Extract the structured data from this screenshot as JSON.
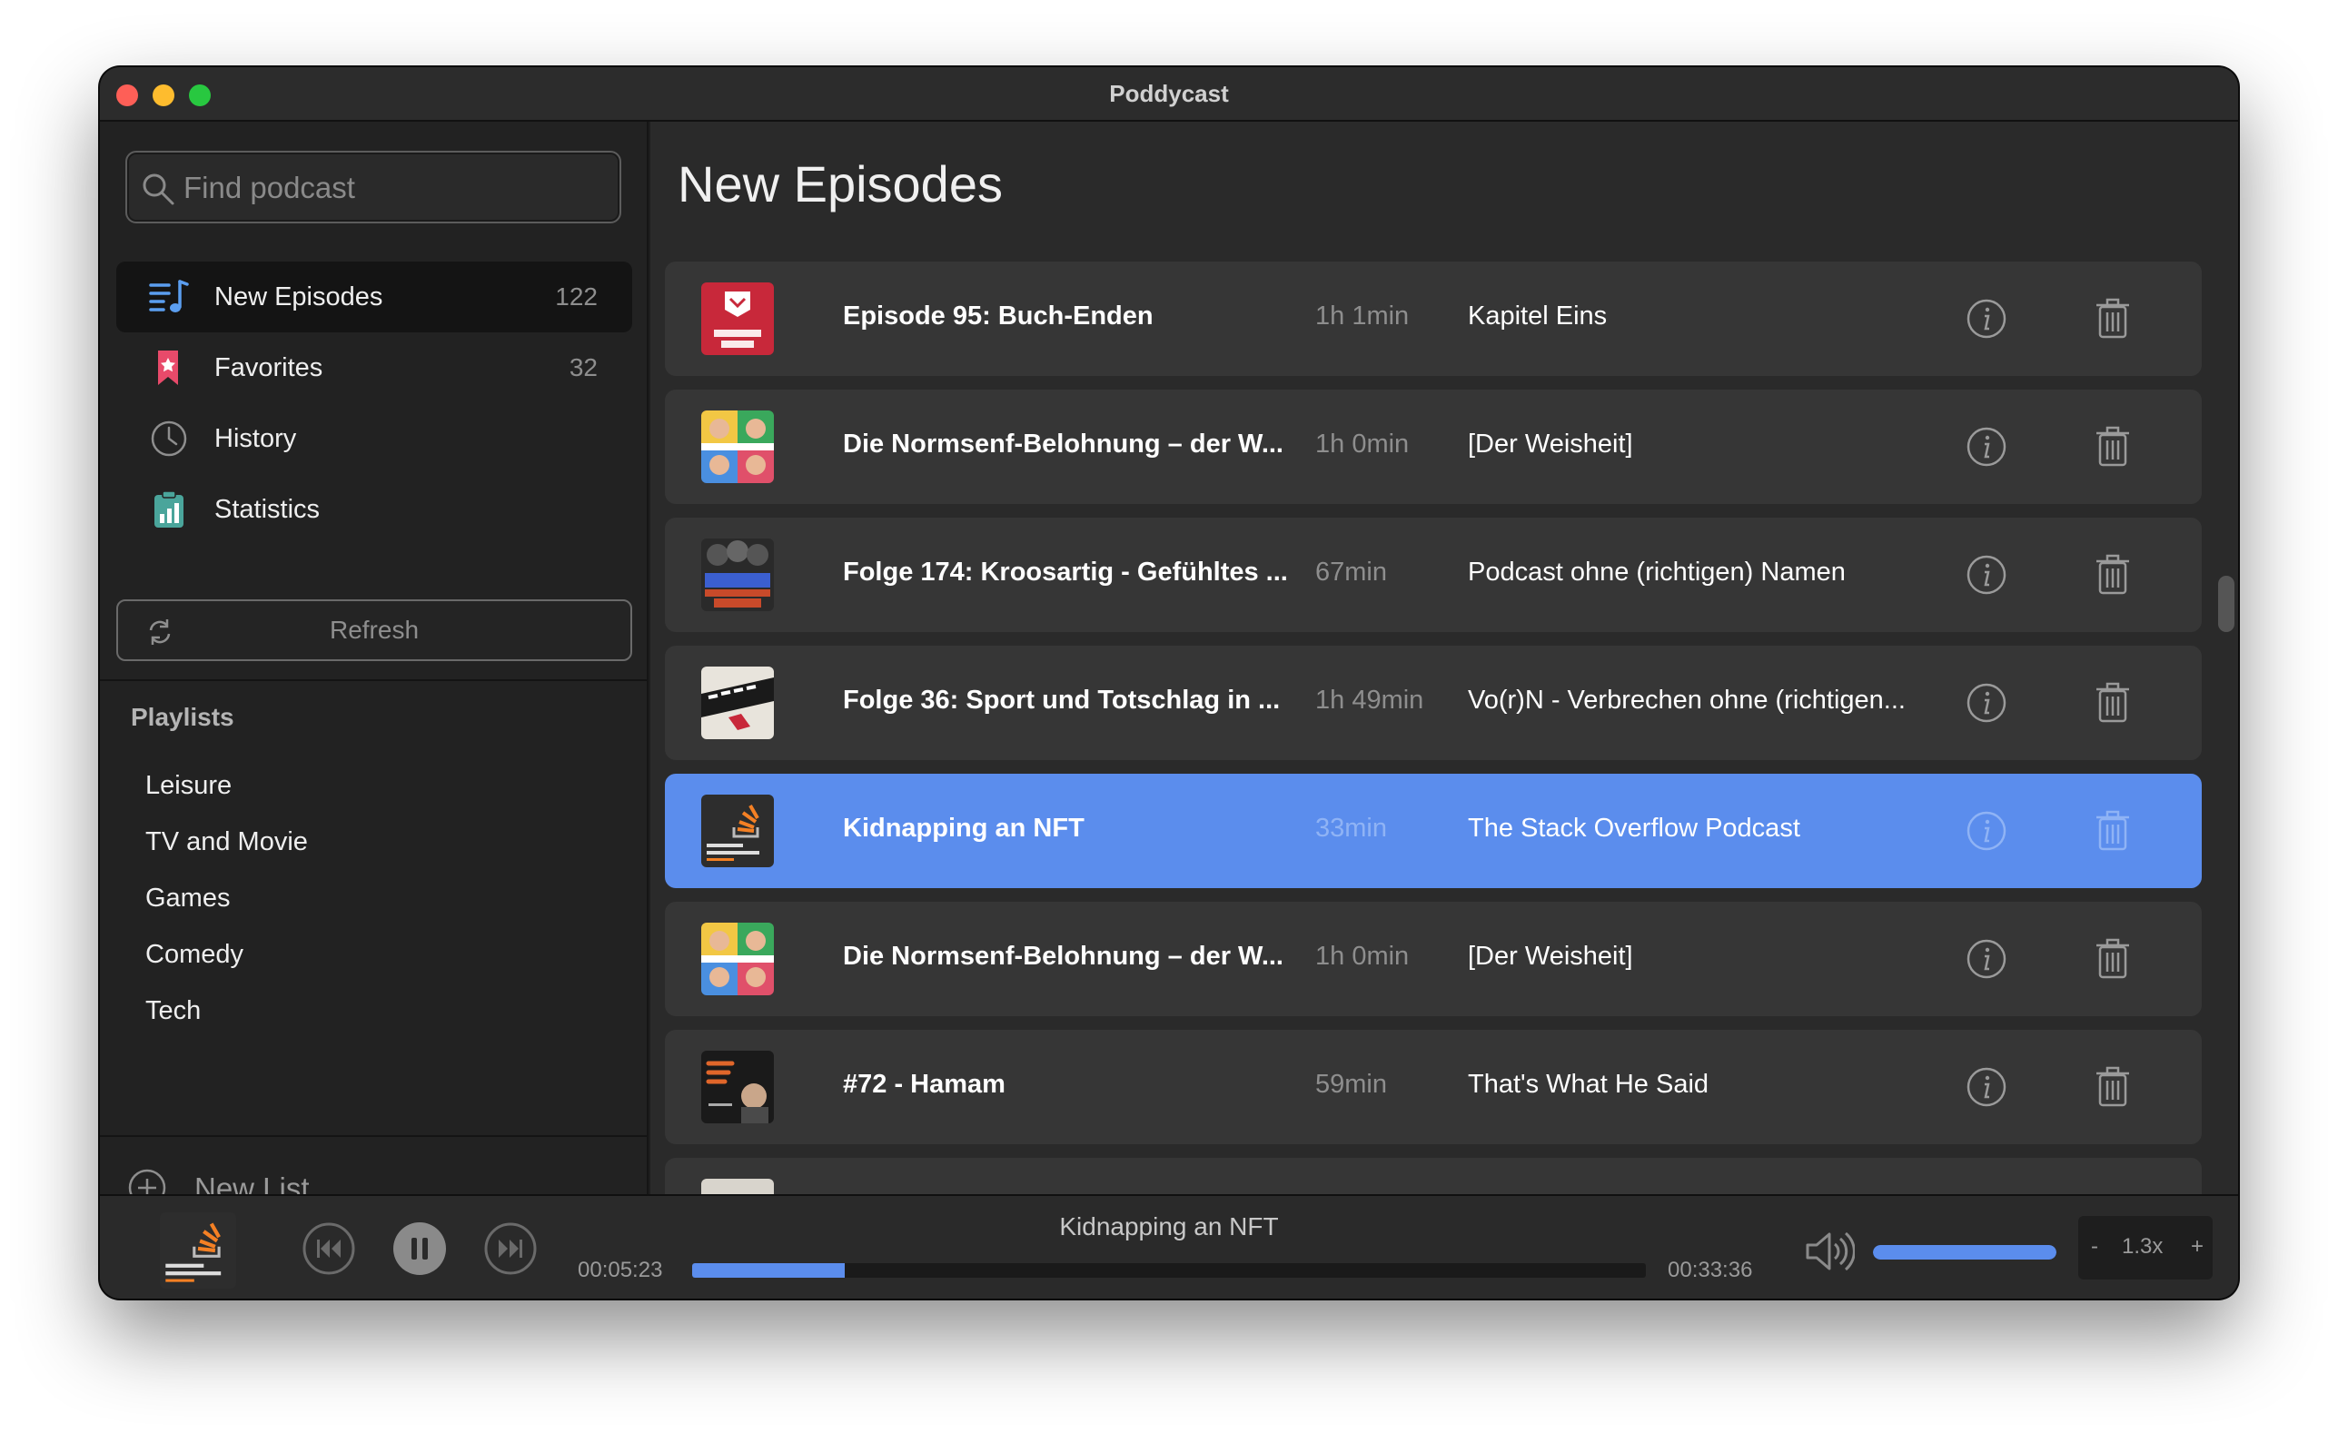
{
  "window": {
    "title": "Poddycast"
  },
  "search": {
    "placeholder": "Find podcast",
    "value": ""
  },
  "nav": [
    {
      "label": "New Episodes",
      "count": "122",
      "icon": "music-list-icon",
      "active": true
    },
    {
      "label": "Favorites",
      "count": "32",
      "icon": "bookmark-icon",
      "active": false
    },
    {
      "label": "History",
      "count": "",
      "icon": "clock-icon",
      "active": false
    },
    {
      "label": "Statistics",
      "count": "",
      "icon": "chart-clipboard-icon",
      "active": false
    }
  ],
  "refresh_label": "Refresh",
  "playlists": {
    "title": "Playlists",
    "items": [
      "Leisure",
      "TV and Movie",
      "Games",
      "Comedy",
      "Tech"
    ],
    "new_list_label": "New List"
  },
  "main": {
    "title": "New Episodes",
    "episodes": [
      {
        "title": "Episode 95: Buch-Enden",
        "duration": "1h 1min",
        "podcast": "Kapitel Eins",
        "art": "kapitel-eins-art",
        "selected": false
      },
      {
        "title": "Die Normsenf-Belohnung – der W...",
        "duration": "1h 0min",
        "podcast": "[Der Weisheit]",
        "art": "der-weisheit-art",
        "selected": false
      },
      {
        "title": "Folge 174: Kroosartig - Gefühltes ...",
        "duration": "67min",
        "podcast": "Podcast ohne (richtigen) Namen",
        "art": "podcast-ohne-namen-art",
        "selected": false
      },
      {
        "title": "Folge 36: Sport und Totschlag in ...",
        "duration": "1h 49min",
        "podcast": "Vo(r)N - Verbrechen ohne (richtigen...",
        "art": "vorn-art",
        "selected": false
      },
      {
        "title": "Kidnapping an NFT",
        "duration": "33min",
        "podcast": "The Stack Overflow Podcast",
        "art": "stack-overflow-art",
        "selected": true
      },
      {
        "title": "Die Normsenf-Belohnung – der W...",
        "duration": "1h 0min",
        "podcast": "[Der Weisheit]",
        "art": "der-weisheit-art",
        "selected": false
      },
      {
        "title": "#72 - Hamam",
        "duration": "59min",
        "podcast": "That's What He Said",
        "art": "thats-what-he-said-art",
        "selected": false
      }
    ]
  },
  "player": {
    "now_playing": "Kidnapping an NFT",
    "elapsed": "00:05:23",
    "total": "00:33:36",
    "progress": 0.16,
    "volume": 1.0,
    "speed": "1.3x",
    "speed_minus": "-",
    "speed_plus": "+"
  },
  "colors": {
    "accent": "#5b8ded",
    "background": "#1e1e1e",
    "row": "#363636"
  }
}
